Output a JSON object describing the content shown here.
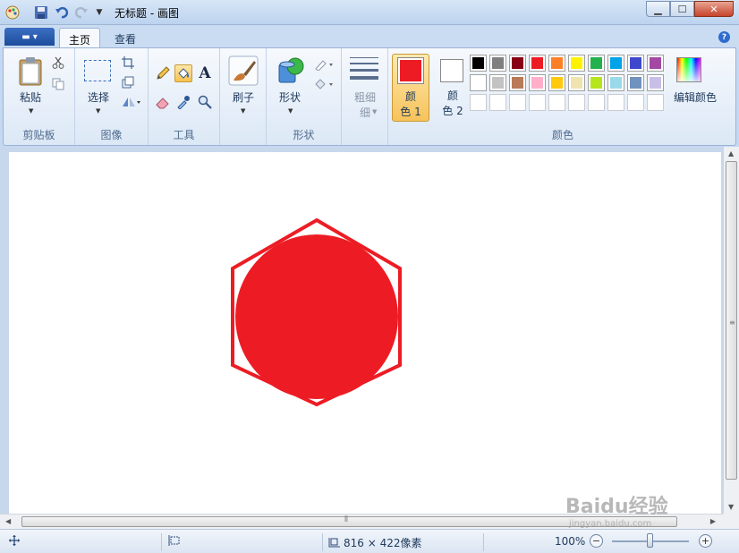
{
  "window": {
    "title": "无标题 - 画图"
  },
  "tabs": [
    {
      "label": "主页",
      "active": true
    },
    {
      "label": "查看",
      "active": false
    }
  ],
  "groups": {
    "clipboard": {
      "label": "剪贴板",
      "paste_label": "粘贴"
    },
    "image": {
      "label": "图像",
      "select_label": "选择"
    },
    "tools": {
      "label": "工具"
    },
    "brushes": {
      "label": "刷子"
    },
    "shapes": {
      "label": "形状",
      "shapes_label": "形状"
    },
    "size": {
      "label": "粗细",
      "label_line2": "细"
    },
    "colors": {
      "label": "颜色",
      "color1_label": "颜",
      "color1_label2": "色 1",
      "color2_label": "颜",
      "color2_label2": "色 2",
      "edit_colors_label": "编辑颜色",
      "color1": "#ed1c24",
      "color2": "#ffffff",
      "palette_row1": [
        "#000000",
        "#7f7f7f",
        "#880015",
        "#ed1c24",
        "#ff7f27",
        "#fff200",
        "#22b14c",
        "#00a2e8",
        "#3f48cc",
        "#a349a4"
      ],
      "palette_row2": [
        "#ffffff",
        "#c3c3c3",
        "#b97a57",
        "#ffaec9",
        "#ffc90e",
        "#efe4b0",
        "#b5e61d",
        "#99d9ea",
        "#7092be",
        "#c8bfe7"
      ],
      "palette_row3": [
        "#ffffff",
        "#ffffff",
        "#ffffff",
        "#ffffff",
        "#ffffff",
        "#ffffff",
        "#ffffff",
        "#ffffff",
        "#ffffff",
        "#ffffff"
      ]
    }
  },
  "canvas": {
    "shape_color": "#ed1c24"
  },
  "status": {
    "size_text": "816 × 422像素",
    "zoom_text": "100%"
  },
  "watermark": {
    "main": "Baidu经验",
    "sub": "jingyan.baidu.com"
  }
}
